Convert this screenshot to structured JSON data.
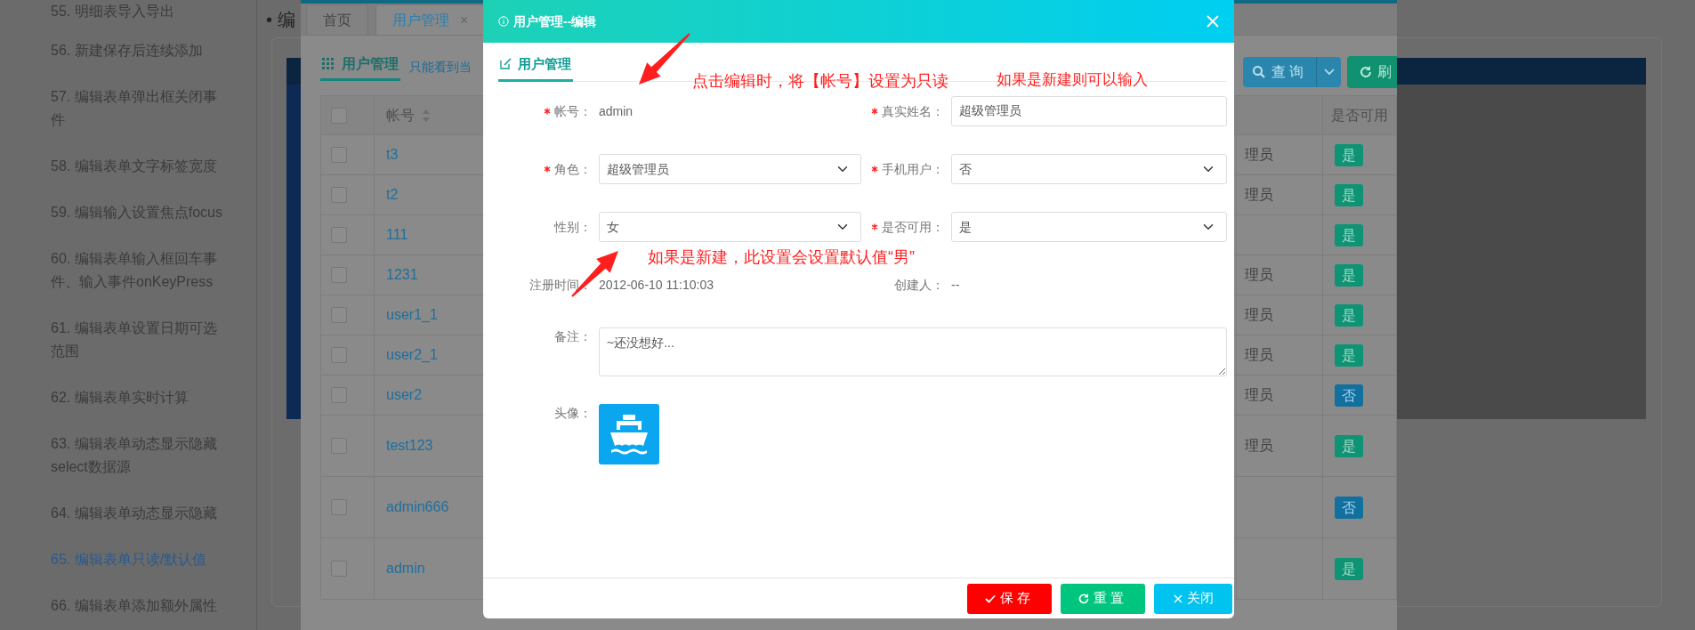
{
  "sidebar": {
    "items": [
      {
        "label": "55. 明细表导入导出",
        "selected": false
      },
      {
        "label": "56. 新建保存后连续添加",
        "selected": false
      },
      {
        "label": "57. 编辑表单弹出框关闭事件",
        "selected": false
      },
      {
        "label": "58. 编辑表单文字标签宽度",
        "selected": false
      },
      {
        "label": "59. 编辑输入设置焦点focus",
        "selected": false
      },
      {
        "label": "60. 编辑表单输入框回车事件、输入事件onKeyPress",
        "selected": false
      },
      {
        "label": "61. 编辑表单设置日期可选范围",
        "selected": false
      },
      {
        "label": "62. 编辑表单实时计算",
        "selected": false
      },
      {
        "label": "63. 编辑表单动态显示隐藏select数据源",
        "selected": false
      },
      {
        "label": "64. 编辑表单动态显示隐藏",
        "selected": false
      },
      {
        "label": "65. 编辑表单只读/默认值",
        "selected": true
      },
      {
        "label": "66. 编辑表单添加额外属性",
        "selected": false
      }
    ]
  },
  "page": {
    "heading": "• 编"
  },
  "app": {
    "tabs": [
      {
        "label": "首页",
        "selected": false
      },
      {
        "label": "用户管理",
        "selected": true,
        "close": "×"
      }
    ],
    "section_tab": "用户管理",
    "hint_link": "只能看到当",
    "query_button": "查询",
    "refresh_button": "刷",
    "table": {
      "header_checked": false,
      "account_header": "帐号",
      "enabled_header": "是否可用",
      "rows": [
        {
          "checked": false,
          "account": "t3",
          "column_3": "理员",
          "enabled": true,
          "badge": "是"
        },
        {
          "checked": false,
          "account": "t2",
          "column_3": "理员",
          "enabled": true,
          "badge": "是"
        },
        {
          "checked": false,
          "account": "111",
          "enabled": true,
          "badge": "是"
        },
        {
          "checked": false,
          "account": "1231",
          "column_3": "理员",
          "enabled": true,
          "badge": "是"
        },
        {
          "checked": false,
          "account": "user1_1",
          "column_3": "理员",
          "enabled": true,
          "badge": "是"
        },
        {
          "checked": false,
          "account": "user2_1",
          "column_3": "理员",
          "enabled": true,
          "badge": "是"
        },
        {
          "checked": false,
          "account": "user2",
          "column_3": "理员",
          "enabled": false,
          "badge": "否"
        },
        {
          "checked": false,
          "account": "test123",
          "column_3": "理员",
          "enabled": true,
          "badge": "是"
        },
        {
          "checked": false,
          "account": "admin666",
          "enabled": false,
          "badge": "否"
        },
        {
          "checked": false,
          "account": "admin",
          "enabled": true,
          "badge": "是"
        }
      ]
    }
  },
  "modal": {
    "title": "用户管理--编辑",
    "tab": "用户管理",
    "fields": [
      {
        "label": "帐号：",
        "required": true,
        "kind": "static",
        "value": "admin"
      },
      {
        "label": "真实姓名：",
        "required": true,
        "kind": "input",
        "value": "超级管理员"
      },
      {
        "label": "角色：",
        "required": true,
        "kind": "select",
        "value": "超级管理员"
      },
      {
        "label": "手机用户：",
        "required": true,
        "kind": "select",
        "value": "否"
      },
      {
        "label": "性别：",
        "required": false,
        "kind": "select",
        "value": "女"
      },
      {
        "label": "是否可用：",
        "required": true,
        "kind": "select",
        "value": "是"
      },
      {
        "label": "注册时间：",
        "required": false,
        "kind": "static",
        "value": "2012-06-10 11:10:03"
      },
      {
        "label": "创建人：",
        "required": false,
        "kind": "static",
        "value": "--"
      },
      {
        "label": "备注：",
        "required": false,
        "kind": "textarea",
        "value": "~还没想好..."
      },
      {
        "label": "头像：",
        "required": false,
        "kind": "image"
      }
    ],
    "annotations": [
      {
        "text": "点击编辑时，将【帐号】设置为只读"
      },
      {
        "text": "如果是新建则可以输入"
      },
      {
        "text": "如果是新建，此设置会设置默认值“男”"
      }
    ],
    "buttons": [
      {
        "label": "保存",
        "kind": "save"
      },
      {
        "label": "重置",
        "kind": "reset"
      },
      {
        "label": "关闭",
        "kind": "close"
      }
    ]
  }
}
